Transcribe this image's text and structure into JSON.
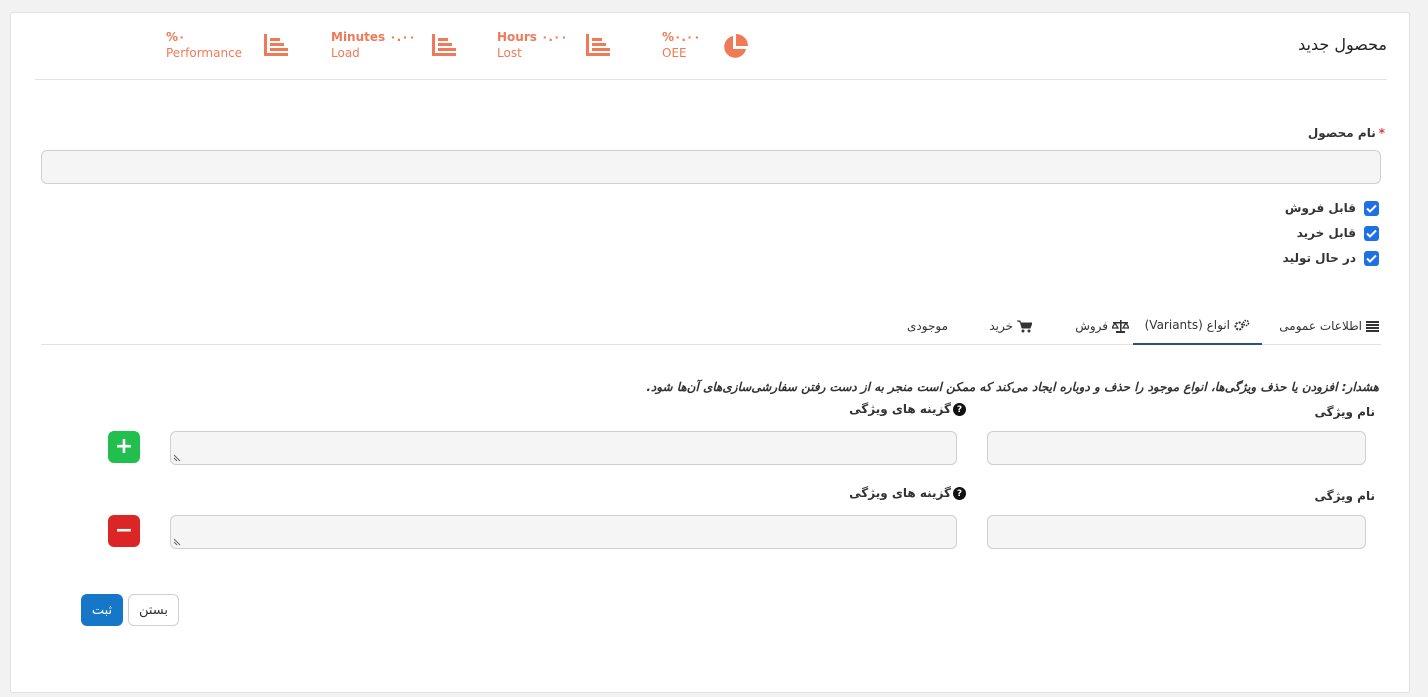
{
  "page_title": "محصول جدید",
  "stats": [
    {
      "top": "%٠",
      "bottom": "Performance",
      "icon": "bar-chart-icon"
    },
    {
      "top": "Minutes ٠.٠٠",
      "bottom": "Load",
      "icon": "bar-chart-icon"
    },
    {
      "top": "Hours ٠.٠٠",
      "bottom": "Lost",
      "icon": "bar-chart-icon"
    },
    {
      "top": "%٠.٠٠",
      "bottom": "OEE",
      "icon": "pie-chart-icon"
    }
  ],
  "form": {
    "product_name_label": "نام محصول",
    "required_mark": "*",
    "product_name_value": "",
    "checkboxes": [
      {
        "label": "قابل فروش",
        "checked": true
      },
      {
        "label": "قابل خرید",
        "checked": true
      },
      {
        "label": "در حال تولید",
        "checked": true
      }
    ]
  },
  "tabs": [
    {
      "label": "اطلاعات عمومی",
      "icon": "list-icon"
    },
    {
      "label": "انواع (Variants)",
      "icon": "gears-icon",
      "active": true
    },
    {
      "label": "فروش",
      "icon": "scale-icon"
    },
    {
      "label": "خرید",
      "icon": "cart-icon"
    },
    {
      "label": "موجودی",
      "icon": ""
    }
  ],
  "variants": {
    "warning": "هشدار: افزودن یا حذف ویژگی‌ها، انواع موجود را حذف و دوباره ایجاد می‌کند که ممکن است منجر به از دست رفتن سفارشی‌سازی‌های آن‌ها شود.",
    "help_glyph": "?",
    "rows": [
      {
        "attribute_label": "نام ویژگی",
        "options_label": "گزینه های ویژگی",
        "attribute_value": "",
        "options_value": "",
        "action": "+"
      },
      {
        "attribute_label": "نام ویژگی",
        "options_label": "گزینه های ویژگی",
        "attribute_value": "",
        "options_value": "",
        "action": "−"
      }
    ]
  },
  "buttons": {
    "submit": "ثبت",
    "close": "بستن"
  },
  "colors": {
    "accent_orange": "#f07a57",
    "primary": "#1677c9",
    "success": "#22bf4e",
    "danger": "#dc2626",
    "checkbox": "#1f6fe5"
  }
}
